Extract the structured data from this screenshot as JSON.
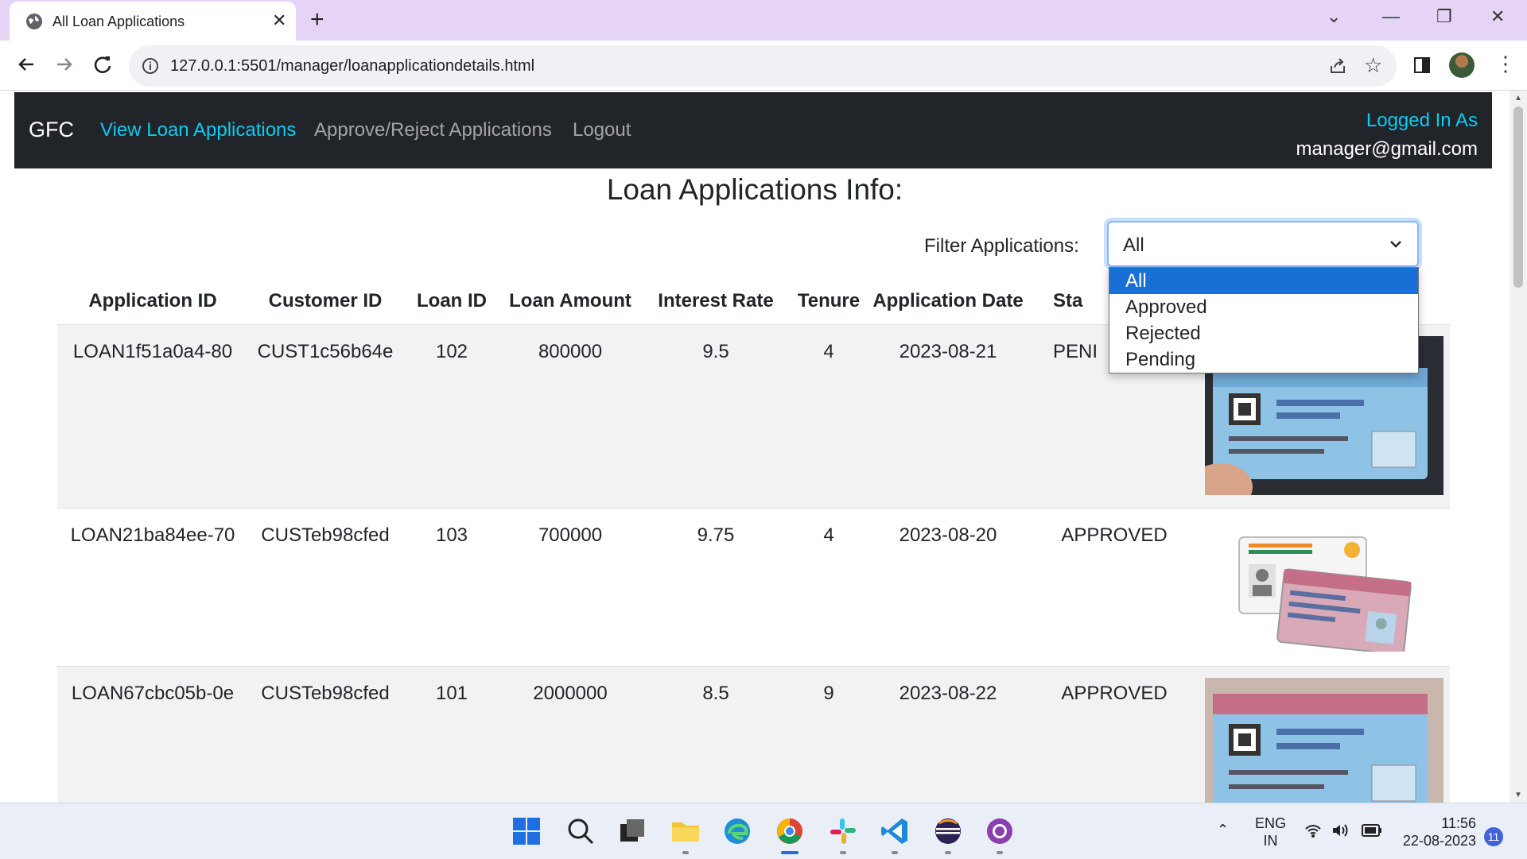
{
  "browser": {
    "tab_title": "All Loan Applications",
    "url": "127.0.0.1:5501/manager/loanapplicationdetails.html"
  },
  "navbar": {
    "brand": "GFC",
    "links": [
      "View Loan Applications",
      "Approve/Reject Applications",
      "Logout"
    ],
    "logged_label": "Logged In As",
    "logged_user": "manager@gmail.com"
  },
  "page": {
    "heading": "Loan Applications Info:",
    "filter_label": "Filter Applications:",
    "filter_value": "All",
    "filter_options": [
      "All",
      "Approved",
      "Rejected",
      "Pending"
    ]
  },
  "table": {
    "headers": [
      "Application ID",
      "Customer ID",
      "Loan ID",
      "Loan Amount",
      "Interest Rate",
      "Tenure",
      "Application Date",
      "Sta",
      ""
    ],
    "rows": [
      [
        "LOAN1f51a0a4-80",
        "CUST1c56b64e",
        "102",
        "800000",
        "9.5",
        "4",
        "2023-08-21",
        "PENI"
      ],
      [
        "LOAN21ba84ee-70",
        "CUSTeb98cfed",
        "103",
        "700000",
        "9.75",
        "4",
        "2023-08-20",
        "APPROVED"
      ],
      [
        "LOAN67cbc05b-0e",
        "CUSTeb98cfed",
        "101",
        "2000000",
        "8.5",
        "9",
        "2023-08-22",
        "APPROVED"
      ]
    ],
    "doc_images": [
      "pan-card",
      "aadhaar-and-pan-cards",
      "pan-card"
    ]
  },
  "taskbar": {
    "lang1": "ENG",
    "lang2": "IN",
    "time": "11:56",
    "date": "22-08-2023",
    "notifications": "11"
  },
  "colors": {
    "navbar_bg": "#212529",
    "active_link": "#0dcaf0",
    "tabstrip": "#e6d4f6",
    "dropdown_selected": "#1a6fd6"
  }
}
